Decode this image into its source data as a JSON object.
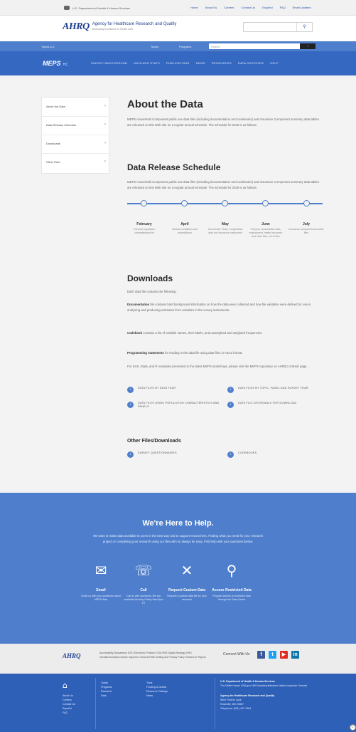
{
  "govbar": {
    "hhs_text": "U.S. Department of Health & Human Services",
    "links": [
      "Home",
      "About Us",
      "Careers",
      "Contact Us",
      "Español",
      "FAQ",
      "Email Updates"
    ]
  },
  "header": {
    "logo_mark": "AHRQ",
    "logo_title": "Agency for Healthcare Research and Quality",
    "logo_tagline": "Advancing Excellence in Health Care",
    "search_placeholder": "",
    "search_icon": "search-icon"
  },
  "topnav": {
    "left_label": "Topics A-Z",
    "menu_1": "Topics",
    "menu_2": "Programs",
    "search_placeholder": "Search",
    "search_button": "Search"
  },
  "mepsnav": {
    "brand": "MEPS",
    "brand_suffix": "HC",
    "items": [
      "SURVEY BACKGROUND",
      "DATA AND STATS",
      "PUBLICATIONS",
      "NEWS",
      "RESOURCES",
      "DATA OVERVIEW",
      "HELP"
    ]
  },
  "sidebar": {
    "items": [
      {
        "label": "About the Data",
        "chevron": "›"
      },
      {
        "label": "Data Release Schedule",
        "chevron": "‹"
      },
      {
        "label": "Downloads",
        "chevron": "‹"
      },
      {
        "label": "Other Files",
        "chevron": "›"
      }
    ]
  },
  "about": {
    "title": "About the Data",
    "text": "MEPS Household Component public use data files (including documentation and codebooks) and Insurance Component summary data tables are released on this Web site on a regular annual schedule. The schedule for 2019 is as follows:"
  },
  "schedule": {
    "title": "Data Release Schedule",
    "text": "MEPS Household Component public use data files (including documentation and codebooks) and Insurance Component summary data tables are released on this Web site on a regular annual schedule. The schedule for 2019 is as follows:",
    "months": [
      {
        "month": "February",
        "desc": "Full year population characteristics file"
      },
      {
        "month": "April",
        "desc": "Medical conditions and expenditures"
      },
      {
        "month": "May",
        "desc": "Household, Panel, Longitudinal data and insurance component"
      },
      {
        "month": "June",
        "desc": "Full year consolidated data, employment, health insurance and other files, event files"
      },
      {
        "month": "July",
        "desc": "Insurance component and other files"
      }
    ]
  },
  "downloads": {
    "title": "Downloads",
    "intro": "Each data file contains the following:",
    "documentation_label": "Documentation",
    "documentation_text": "file contains brief background information on how the data were collected and how file variables were defined for use in analysing and producing estimates from variables in the survey instruments.",
    "codebook_label": "Codebook",
    "codebook_text": "contains a list of variable names, their labels, and unweighted and weighted frequencies.",
    "programming_label": "Programming statements",
    "programming_text": "for reading in the data file using data files in ASCII format.",
    "note": "For SAS, Stata, and R examples presented in the latest MEPS workshops, please visit the MEPS repository on AHRQ's GitHub page.",
    "links": [
      "DATA FILES BY DATA YEAR",
      "DATA FILES BY TOPIC, PANEL AND SURVEY YEAR",
      "DATA FILES USING POPULATION CHARACTERISTICS AND PANELS",
      "DATA FILE CROSSWALK FOR DOWNLOAD"
    ]
  },
  "other": {
    "title": "Other Files/Downloads",
    "links": [
      "SURVEY QUESTIONNAIRES",
      "CODEBOOKS"
    ]
  },
  "help": {
    "title": "We're Here to Help.",
    "text": "We want to make data available to users in the best way and to support researchers. Finding what you need for your research project or completing your research using our files will not always be easy. Find help with your questions below.",
    "cards": [
      {
        "icon": "envelope-icon",
        "glyph": "✉",
        "name": "Email",
        "desc": "Email us with your questions about MEPS data"
      },
      {
        "icon": "phone-icon",
        "glyph": "☏",
        "name": "Call",
        "desc": "Call us with questions. We are available Monday-Friday 9am-5pm ET"
      },
      {
        "icon": "tools-icon",
        "glyph": "✕",
        "name": "Request Custom Data",
        "desc": "Request a custom data file for your research"
      },
      {
        "icon": "key-icon",
        "glyph": "⚲",
        "name": "Access Restricted Data",
        "desc": "Request access to restricted data through the Data Center"
      }
    ]
  },
  "footer": {
    "logo": "AHRQ",
    "links_text": "Accessibility  Disclaimers  EEO  Electronic Policies  FOIA  HHS Digital Strategy  HHS Nondiscrimination Notice  Inspector General  Plain Writing Act  Privacy Policy  Viewers & Players",
    "connect_label": "Connect With Us",
    "social": [
      {
        "name": "facebook",
        "glyph": "f",
        "color": "#3b5998"
      },
      {
        "name": "twitter",
        "glyph": "t",
        "color": "#1da1f2"
      },
      {
        "name": "youtube",
        "glyph": "▶",
        "color": "#e02a20"
      },
      {
        "name": "linkedin",
        "glyph": "in",
        "color": "#0e76a8"
      }
    ]
  },
  "bottom": {
    "col1": [
      "About Us",
      "Careers",
      "Contact Us",
      "Español",
      "FAQ"
    ],
    "col2": [
      "Topics",
      "Programs",
      "Research",
      "Data"
    ],
    "col3": [
      "Tools",
      "Funding & Grants",
      "Research Findings",
      "News"
    ],
    "address_title": "U.S. Department of Health & Human Services",
    "address_links": "The White House  USA.gov  HHS Nondiscrimination Notice  Inspector General",
    "agency": "Agency for Healthcare Research and Quality",
    "street": "5600 Fishers Lane",
    "city": "Rockville, MD 20857",
    "phone": "Telephone: (301) 427-1364"
  }
}
